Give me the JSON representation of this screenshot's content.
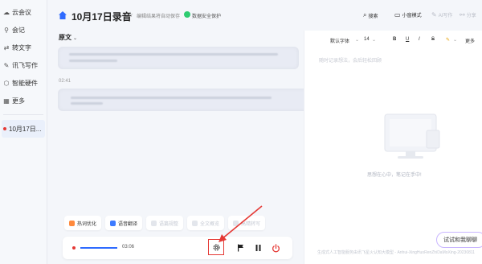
{
  "sidebar": {
    "items": [
      {
        "label": "云会议",
        "icon": "cloud-icon"
      },
      {
        "label": "会记",
        "icon": "mic-icon"
      },
      {
        "label": "转文字",
        "icon": "convert-icon"
      },
      {
        "label": "讯飞写作",
        "icon": "pen-icon"
      },
      {
        "label": "智能硬件",
        "icon": "device-icon"
      },
      {
        "label": "更多",
        "icon": "grid-icon"
      }
    ],
    "active_recording": "10月17日..."
  },
  "header": {
    "title": "10月17日录音",
    "autosave_hint": "编辑结果将自动保存",
    "secure_label": "数据安全保护",
    "actions": {
      "search": "搜索",
      "mini_mode": "小窗模式",
      "ai_write": "AI写作",
      "share": "分享"
    }
  },
  "transcript": {
    "section_label": "原文",
    "timestamp": "02:41"
  },
  "editor": {
    "font_family": "默认字体",
    "font_size": "14",
    "bold": "B",
    "underline": "U",
    "strike": "S",
    "more": "更多",
    "placeholder": "随时记录想法，会后轻松回顾",
    "empty_text": "思想在心中，笔记在手中!",
    "footnote": "生成式人工智能服务由讯飞星火认知大模型 - Anhui-XingHuoRenZhiDaMoXing-20230811"
  },
  "chips": [
    {
      "label": "热词优化",
      "enabled": true,
      "color": "#ff8a3d"
    },
    {
      "label": "语音翻译",
      "enabled": true,
      "color": "#3d7bff"
    },
    {
      "label": "语篇规整",
      "enabled": false,
      "color": "#c5c9d3"
    },
    {
      "label": "全文概览",
      "enabled": false,
      "color": "#c5c9d3"
    },
    {
      "label": "高精转写",
      "enabled": false,
      "color": "#c5c9d3"
    }
  ],
  "player": {
    "time": "03:06"
  },
  "ai_bubble": "试试和我聊聊"
}
